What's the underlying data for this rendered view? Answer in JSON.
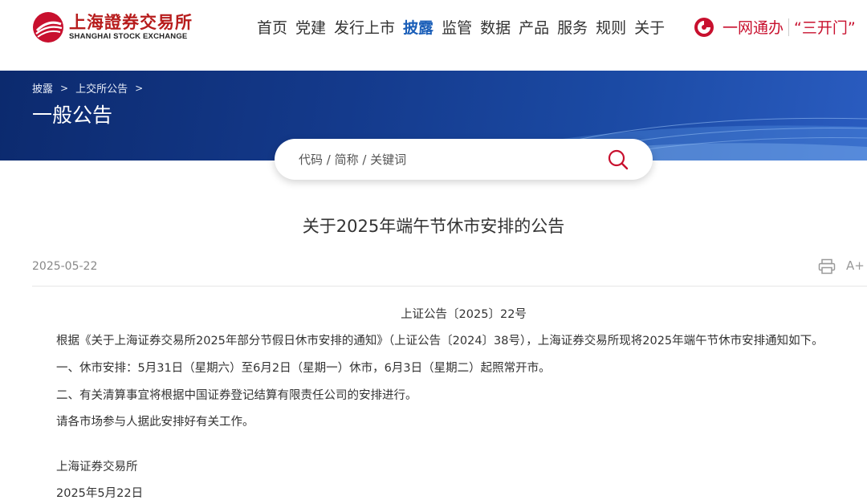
{
  "header": {
    "logo_cn": "上海證券交易所",
    "logo_en": "SHANGHAI STOCK EXCHANGE",
    "nav": [
      "首页",
      "党建",
      "发行上市",
      "披露",
      "监管",
      "数据",
      "产品",
      "服务",
      "规则",
      "关于"
    ],
    "active_nav": "披露",
    "yiwang_label": "一网通办",
    "sankai_label": "“三开门”"
  },
  "banner": {
    "breadcrumb": [
      "披露",
      "上交所公告"
    ],
    "title": "一般公告"
  },
  "search": {
    "placeholder": "代码 / 简称 / 关键词"
  },
  "article": {
    "title": "关于2025年端午节休市安排的公告",
    "date": "2025-05-22",
    "font_size_label": "A+",
    "doc_number": "上证公告〔2025〕22号",
    "paragraphs": [
      "根据《关于上海证券交易所2025年部分节假日休市安排的通知》（上证公告〔2024〕38号），上海证券交易所现将2025年端午节休市安排通知如下。",
      "一、休市安排：5月31日（星期六）至6月2日（星期一）休市，6月3日（星期二）起照常开市。",
      "二、有关清算事宜将根据中国证券登记结算有限责任公司的安排进行。",
      "请各市场参与人据此安排好有关工作。"
    ],
    "signature": "上海证券交易所",
    "sign_date": "2025年5月22日"
  },
  "colors": {
    "brand_red": "#c8102e",
    "nav_active": "#1a5eb8",
    "banner_blue": "#143a8c"
  }
}
